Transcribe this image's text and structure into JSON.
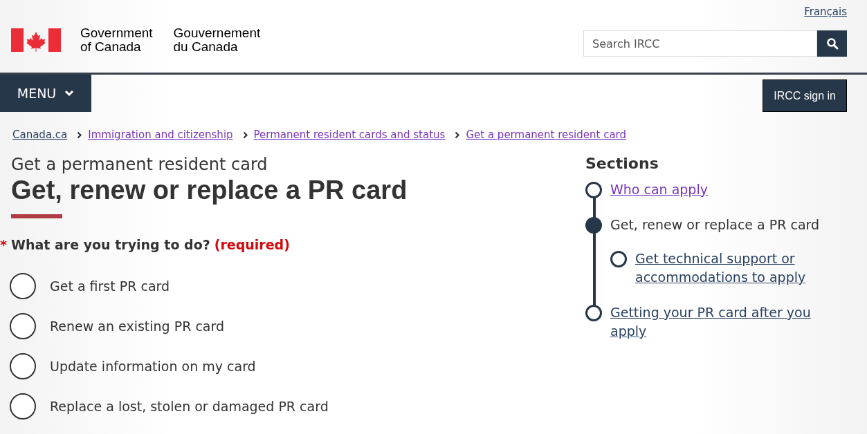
{
  "header": {
    "language_link": "Français",
    "signature_en": [
      "Government",
      "of Canada"
    ],
    "signature_fr": [
      "Gouvernement",
      "du Canada"
    ],
    "search": {
      "placeholder": "Search IRCC"
    }
  },
  "nav": {
    "menu_label": "MENU",
    "sign_in": "IRCC sign in"
  },
  "breadcrumbs": [
    {
      "label": "Canada.ca",
      "visited": false
    },
    {
      "label": "Immigration and citizenship",
      "visited": true
    },
    {
      "label": "Permanent resident cards and status",
      "visited": true
    },
    {
      "label": "Get a permanent resident card",
      "visited": true
    }
  ],
  "page": {
    "subtitle": "Get a permanent resident card",
    "title": "Get, renew or replace a PR card"
  },
  "question": {
    "required_mark": "*",
    "label": "What are you trying to do?",
    "required_text": "(required)",
    "options": [
      {
        "label": "Get a first PR card",
        "selected": false
      },
      {
        "label": "Renew an existing PR card",
        "selected": false
      },
      {
        "label": "Update information on my card",
        "selected": false
      },
      {
        "label": "Replace a lost, stolen or damaged PR card",
        "selected": false
      }
    ]
  },
  "sections": {
    "heading": "Sections",
    "items": [
      {
        "label": "Who can apply",
        "current": false,
        "visited": true
      },
      {
        "label": "Get, renew or replace a PR card",
        "current": true,
        "children": [
          {
            "label": "Get technical support or accommodations to apply",
            "current": false,
            "visited": false
          }
        ]
      },
      {
        "label": "Getting your PR card after you apply",
        "current": false,
        "visited": false
      }
    ]
  }
}
